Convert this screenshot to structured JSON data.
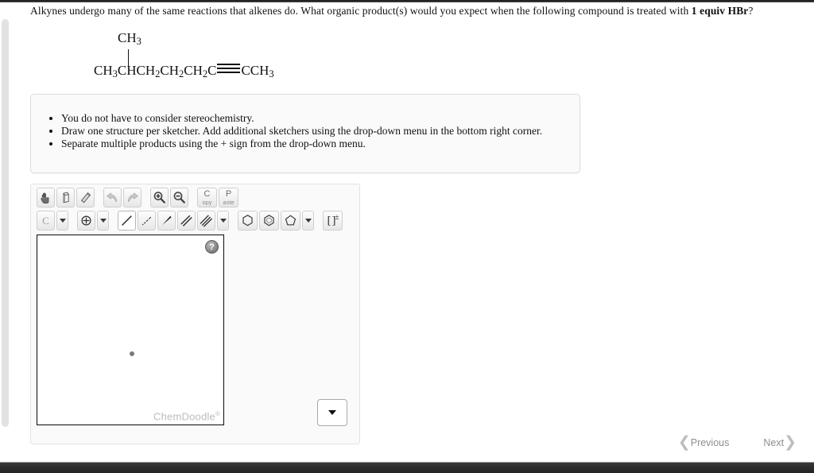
{
  "question": {
    "text_before": "Alkynes undergo many of the same reactions that alkenes do. What organic product(s) would you expect when the following compound is treated with ",
    "text_bold": "1 equiv HBr",
    "text_after": "?"
  },
  "structure": {
    "branch_label": "CH3",
    "branch_label_main": "CH",
    "branch_label_sub": "3",
    "chain_segment_1": "CH",
    "chain_sub_1": "3",
    "chain_segment_2": "CHCH",
    "chain_sub_2": "2",
    "chain_segment_3": "CH",
    "chain_sub_3": "2",
    "chain_segment_4": "CH",
    "chain_sub_4": "2",
    "chain_segment_5": "C",
    "chain_segment_6": "CCH",
    "chain_sub_6": "3",
    "bond_type": "triple",
    "formula_text": "CH3CHCH2CH2CH2C≡CCH3"
  },
  "instructions": {
    "items": [
      "You do not have to consider stereochemistry.",
      "Draw one structure per sketcher. Add additional sketchers using the drop-down menu in the bottom right corner.",
      "Separate multiple products using the + sign from the drop-down menu."
    ]
  },
  "sketcher": {
    "toolbar_row1": [
      {
        "name": "hand-pan-icon",
        "title": "Pan"
      },
      {
        "name": "lasso-select-icon",
        "title": "Lasso"
      },
      {
        "name": "eraser-icon",
        "title": "Erase"
      },
      {
        "name": "undo-arrow-icon",
        "title": "Undo"
      },
      {
        "name": "redo-arrow-icon",
        "title": "Redo"
      },
      {
        "name": "zoom-in-icon",
        "title": "Zoom In"
      },
      {
        "name": "zoom-out-icon",
        "title": "Zoom Out"
      },
      {
        "name": "copy-button",
        "title": "Copy",
        "label_big": "C",
        "label_small": "opy"
      },
      {
        "name": "paste-button",
        "title": "Paste",
        "label_big": "P",
        "label_small": "aste"
      }
    ],
    "toolbar_row2": [
      {
        "name": "carbon-atom-label-button",
        "label": "C"
      },
      {
        "name": "carbon-dropdown-caret",
        "label": ""
      },
      {
        "name": "charge-atom-button",
        "label": ""
      },
      {
        "name": "charge-dropdown-caret",
        "label": ""
      },
      {
        "name": "single-bond-button",
        "label": ""
      },
      {
        "name": "hashed-wedge-bond-button",
        "label": ""
      },
      {
        "name": "solid-wedge-bond-button",
        "label": ""
      },
      {
        "name": "double-bond-button",
        "label": ""
      },
      {
        "name": "triple-bond-button",
        "label": ""
      },
      {
        "name": "bond-dropdown-caret",
        "label": ""
      },
      {
        "name": "benzene-ring-button",
        "label": ""
      },
      {
        "name": "aromatic-ring-button",
        "label": ""
      },
      {
        "name": "cyclopentane-ring-button",
        "label": ""
      },
      {
        "name": "ring-dropdown-caret",
        "label": ""
      },
      {
        "name": "bracket-charge-button",
        "label": "[ ]±"
      }
    ],
    "bracket_button_label": "[ ]",
    "bracket_button_sup": "±",
    "carbon_button_label": "C",
    "help_button_label": "?",
    "watermark": "ChemDoodle",
    "watermark_sup": "®",
    "add_sketcher_dropdown_value": ""
  },
  "navigation": {
    "previous_label": "Previous",
    "next_label": "Next",
    "previous_chevron": "❮",
    "next_chevron": "❯"
  },
  "colors": {
    "panel_background": "#fafafa",
    "panel_border": "#e3e3e3",
    "canvas_border": "#0a0a0a",
    "watermark": "#bcbcbc",
    "nav_text": "#8e8e8e"
  }
}
